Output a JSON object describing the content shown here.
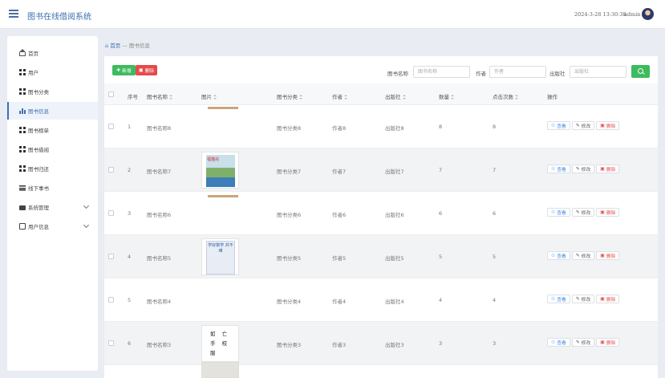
{
  "header": {
    "app_title": "图书在线借阅系统",
    "datetime": "2024-3-28 13:30:38",
    "username": "admin"
  },
  "sidebar": {
    "items": [
      {
        "label": "首页",
        "icon": "home-icon"
      },
      {
        "label": "用户",
        "icon": "grid-icon"
      },
      {
        "label": "图书分类",
        "icon": "grid-icon"
      },
      {
        "label": "图书信息",
        "icon": "bar-chart-icon",
        "active": true
      },
      {
        "label": "图书榜单",
        "icon": "grid-icon"
      },
      {
        "label": "图书借阅",
        "icon": "grid-icon"
      },
      {
        "label": "图书归还",
        "icon": "grid-icon"
      },
      {
        "label": "线下事书",
        "icon": "list-icon"
      },
      {
        "label": "系统管理",
        "icon": "briefcase-icon",
        "expandable": true
      },
      {
        "label": "用户信息",
        "icon": "document-icon",
        "expandable": true
      }
    ]
  },
  "breadcrumb": {
    "home": "首页",
    "sep": "—",
    "current": "图书信息"
  },
  "toolbar": {
    "add_label": "新增",
    "delete_label": "删除"
  },
  "filters": {
    "name": {
      "label": "图书名称",
      "placeholder": "图书名称"
    },
    "author": {
      "label": "作者",
      "placeholder": "作者"
    },
    "publisher": {
      "label": "出版社",
      "placeholder": "出版社"
    }
  },
  "table": {
    "columns": [
      "序号",
      "图书名称",
      "图片",
      "图书分类",
      "作者",
      "出版社",
      "数量",
      "点击次数",
      "操作"
    ],
    "rows": [
      {
        "no": "1",
        "name": "图书名称8",
        "category": "图书分类8",
        "author": "作者8",
        "publisher": "出版社8",
        "qty": "8",
        "clicks": "8",
        "cover": "thin"
      },
      {
        "no": "2",
        "name": "图书名称7",
        "category": "图书分类7",
        "author": "作者7",
        "publisher": "出版社7",
        "qty": "7",
        "clicks": "7",
        "cover": "full"
      },
      {
        "no": "3",
        "name": "图书名称6",
        "category": "图书分类6",
        "author": "作者6",
        "publisher": "出版社6",
        "qty": "6",
        "clicks": "6",
        "cover": "thin"
      },
      {
        "no": "4",
        "name": "图书名称5",
        "category": "图书分类5",
        "author": "作者5",
        "publisher": "出版社5",
        "qty": "5",
        "clicks": "5",
        "cover": "full"
      },
      {
        "no": "5",
        "name": "图书名称4",
        "category": "图书分类4",
        "author": "作者4",
        "publisher": "出版社4",
        "qty": "4",
        "clicks": "4",
        "cover": "none"
      },
      {
        "no": "6",
        "name": "图书名称3",
        "category": "图书分类3",
        "author": "作者3",
        "publisher": "出版社3",
        "qty": "3",
        "clicks": "3",
        "cover": "full"
      }
    ],
    "actions": {
      "view": "查看",
      "edit": "修改",
      "delete": "删除"
    }
  },
  "covers": {
    "row2": {
      "title": "福猫兆"
    },
    "row4": {
      "title": "学好数学 并不难"
    },
    "row6": {
      "title": "如 亡 手 校 服"
    }
  }
}
